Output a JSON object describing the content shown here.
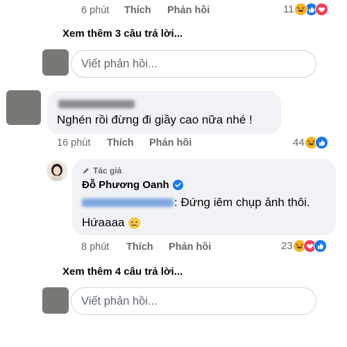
{
  "thread_top": {
    "time": "6 phút",
    "like_label": "Thích",
    "reply_label": "Phản hồi",
    "reaction_count": "11",
    "reaction_icons": [
      "haha-icon",
      "like-icon",
      "love-icon"
    ]
  },
  "see_more_1": "Xem thêm 3 câu trả lời...",
  "reply_input_1": {
    "placeholder": "Viết phản hồi..."
  },
  "comment_2": {
    "text": "Nghén rồi đừng đi giầy cao nữa nhé !",
    "time": "16 phút",
    "like_label": "Thích",
    "reply_label": "Phản hồi",
    "reaction_count": "44",
    "reaction_icons": [
      "haha-icon",
      "like-icon"
    ]
  },
  "author_reply": {
    "badge": "Tác giả",
    "name": "Đỗ Phương Oanh",
    "line1_suffix": ": Đứng iêm chụp ảnh thôi.",
    "line2": "Hứaaaa",
    "emoji": "sad-face-icon",
    "time": "8 phút",
    "like_label": "Thích",
    "reply_label": "Phản hồi",
    "reaction_count": "23",
    "reaction_icons": [
      "haha-icon",
      "love-icon",
      "like-icon"
    ]
  },
  "see_more_2": "Xem thêm 4 câu trả lời...",
  "reply_input_2": {
    "placeholder": "Viết phản hồi..."
  },
  "colors": {
    "like_blue": "#1877f2",
    "love_red": "#f33e58",
    "haha_yellow": "#f7b125",
    "meta_gray": "#65676b",
    "bubble_gray": "#f0f2f5"
  }
}
